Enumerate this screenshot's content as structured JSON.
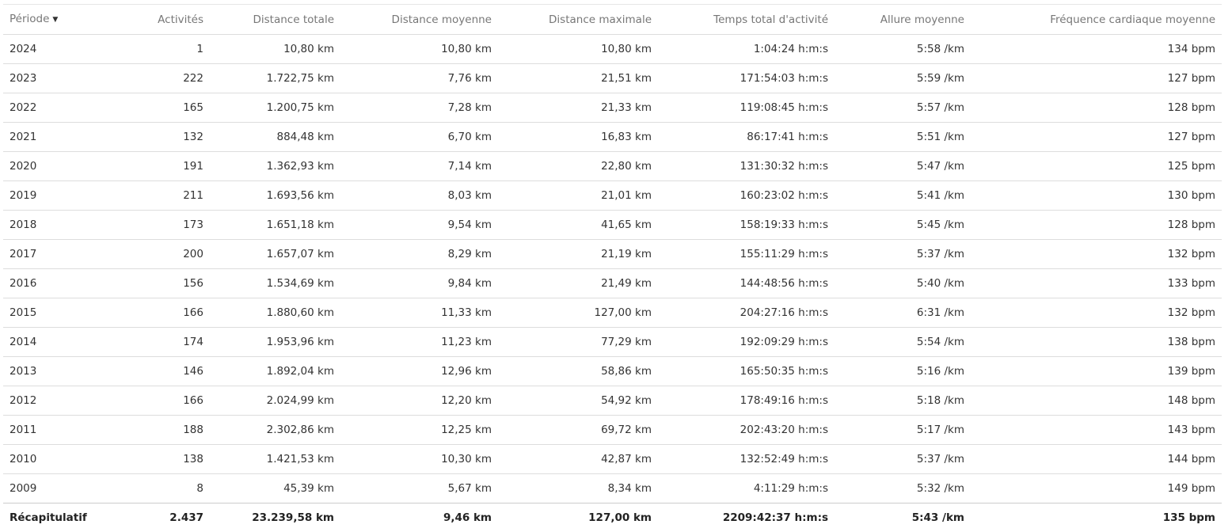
{
  "table": {
    "columns": [
      "Période",
      "Activités",
      "Distance totale",
      "Distance moyenne",
      "Distance maximale",
      "Temps total d'activité",
      "Allure moyenne",
      "Fréquence cardiaque moyenne"
    ],
    "sort_icon": "caret-down-icon",
    "rows": [
      [
        "2024",
        "1",
        "10,80 km",
        "10,80 km",
        "10,80 km",
        "1:04:24 h:m:s",
        "5:58 /km",
        "134 bpm"
      ],
      [
        "2023",
        "222",
        "1.722,75 km",
        "7,76 km",
        "21,51 km",
        "171:54:03 h:m:s",
        "5:59 /km",
        "127 bpm"
      ],
      [
        "2022",
        "165",
        "1.200,75 km",
        "7,28 km",
        "21,33 km",
        "119:08:45 h:m:s",
        "5:57 /km",
        "128 bpm"
      ],
      [
        "2021",
        "132",
        "884,48 km",
        "6,70 km",
        "16,83 km",
        "86:17:41 h:m:s",
        "5:51 /km",
        "127 bpm"
      ],
      [
        "2020",
        "191",
        "1.362,93 km",
        "7,14 km",
        "22,80 km",
        "131:30:32 h:m:s",
        "5:47 /km",
        "125 bpm"
      ],
      [
        "2019",
        "211",
        "1.693,56 km",
        "8,03 km",
        "21,01 km",
        "160:23:02 h:m:s",
        "5:41 /km",
        "130 bpm"
      ],
      [
        "2018",
        "173",
        "1.651,18 km",
        "9,54 km",
        "41,65 km",
        "158:19:33 h:m:s",
        "5:45 /km",
        "128 bpm"
      ],
      [
        "2017",
        "200",
        "1.657,07 km",
        "8,29 km",
        "21,19 km",
        "155:11:29 h:m:s",
        "5:37 /km",
        "132 bpm"
      ],
      [
        "2016",
        "156",
        "1.534,69 km",
        "9,84 km",
        "21,49 km",
        "144:48:56 h:m:s",
        "5:40 /km",
        "133 bpm"
      ],
      [
        "2015",
        "166",
        "1.880,60 km",
        "11,33 km",
        "127,00 km",
        "204:27:16 h:m:s",
        "6:31 /km",
        "132 bpm"
      ],
      [
        "2014",
        "174",
        "1.953,96 km",
        "11,23 km",
        "77,29 km",
        "192:09:29 h:m:s",
        "5:54 /km",
        "138 bpm"
      ],
      [
        "2013",
        "146",
        "1.892,04 km",
        "12,96 km",
        "58,86 km",
        "165:50:35 h:m:s",
        "5:16 /km",
        "139 bpm"
      ],
      [
        "2012",
        "166",
        "2.024,99 km",
        "12,20 km",
        "54,92 km",
        "178:49:16 h:m:s",
        "5:18 /km",
        "148 bpm"
      ],
      [
        "2011",
        "188",
        "2.302,86 km",
        "12,25 km",
        "69,72 km",
        "202:43:20 h:m:s",
        "5:17 /km",
        "143 bpm"
      ],
      [
        "2010",
        "138",
        "1.421,53 km",
        "10,30 km",
        "42,87 km",
        "132:52:49 h:m:s",
        "5:37 /km",
        "144 bpm"
      ],
      [
        "2009",
        "8",
        "45,39 km",
        "5,67 km",
        "8,34 km",
        "4:11:29 h:m:s",
        "5:32 /km",
        "149 bpm"
      ]
    ],
    "summary": [
      "Récapitulatif",
      "2.437",
      "23.239,58 km",
      "9,46 km",
      "127,00 km",
      "2209:42:37 h:m:s",
      "5:43 /km",
      "135 bpm"
    ]
  }
}
